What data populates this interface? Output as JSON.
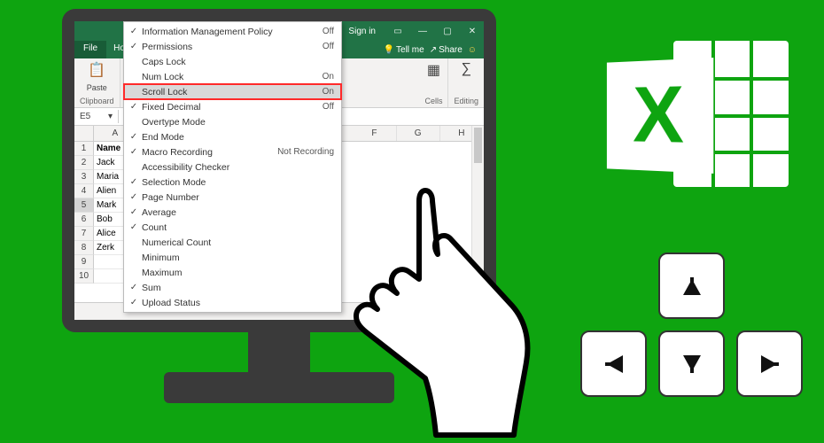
{
  "colors": {
    "brand": "#217346",
    "bg": "#0ea410",
    "highlight_border": "#ff2a2a"
  },
  "titlebar": {
    "signin": "Sign in",
    "face": "☺",
    "min": "—",
    "max": "▢",
    "close": "✕",
    "ribbon_toggle": "▭"
  },
  "tabs": {
    "file": "File",
    "home_partial": "Ho",
    "tell_me": "Tell me",
    "share": "Share",
    "tell_me_icon": "💡",
    "share_icon": "↗"
  },
  "ribbon": {
    "paste_icon": "📋",
    "paste": "Paste",
    "clipboard": "Clipboard",
    "cells_icon": "▦",
    "cells": "Cells",
    "editing_icon": "∑",
    "editing": "Editing"
  },
  "namebox": {
    "ref": "E5",
    "arrow": "▾"
  },
  "columns": [
    "A",
    "F",
    "G",
    "H"
  ],
  "rows": [
    {
      "n": "1",
      "a": "Name",
      "header": true
    },
    {
      "n": "2",
      "a": "Jack"
    },
    {
      "n": "3",
      "a": "Maria"
    },
    {
      "n": "4",
      "a": "Alien"
    },
    {
      "n": "5",
      "a": "Mark",
      "sel": true
    },
    {
      "n": "6",
      "a": "Bob"
    },
    {
      "n": "7",
      "a": "Alice"
    },
    {
      "n": "8",
      "a": "Zerk"
    },
    {
      "n": "9",
      "a": ""
    },
    {
      "n": "10",
      "a": ""
    }
  ],
  "menu": [
    {
      "chk": true,
      "label": "Information Management Policy",
      "val": "Off"
    },
    {
      "chk": true,
      "label": "Permissions",
      "val": "Off"
    },
    {
      "chk": false,
      "label": "Caps Lock",
      "val": ""
    },
    {
      "chk": false,
      "label": "Num Lock",
      "val": "On"
    },
    {
      "chk": false,
      "label": "Scroll Lock",
      "val": "On",
      "highlight": true
    },
    {
      "chk": true,
      "label": "Fixed Decimal",
      "val": "Off"
    },
    {
      "chk": false,
      "label": "Overtype Mode",
      "val": ""
    },
    {
      "chk": true,
      "label": "End Mode",
      "val": ""
    },
    {
      "chk": true,
      "label": "Macro Recording",
      "val": "Not Recording"
    },
    {
      "chk": false,
      "label": "Accessibility Checker",
      "val": ""
    },
    {
      "chk": true,
      "label": "Selection Mode",
      "val": ""
    },
    {
      "chk": true,
      "label": "Page Number",
      "val": ""
    },
    {
      "chk": true,
      "label": "Average",
      "val": ""
    },
    {
      "chk": true,
      "label": "Count",
      "val": ""
    },
    {
      "chk": false,
      "label": "Numerical Count",
      "val": ""
    },
    {
      "chk": false,
      "label": "Minimum",
      "val": ""
    },
    {
      "chk": false,
      "label": "Maximum",
      "val": ""
    },
    {
      "chk": true,
      "label": "Sum",
      "val": ""
    },
    {
      "chk": true,
      "label": "Upload Status",
      "val": ""
    }
  ],
  "logo": {
    "letter": "X"
  }
}
